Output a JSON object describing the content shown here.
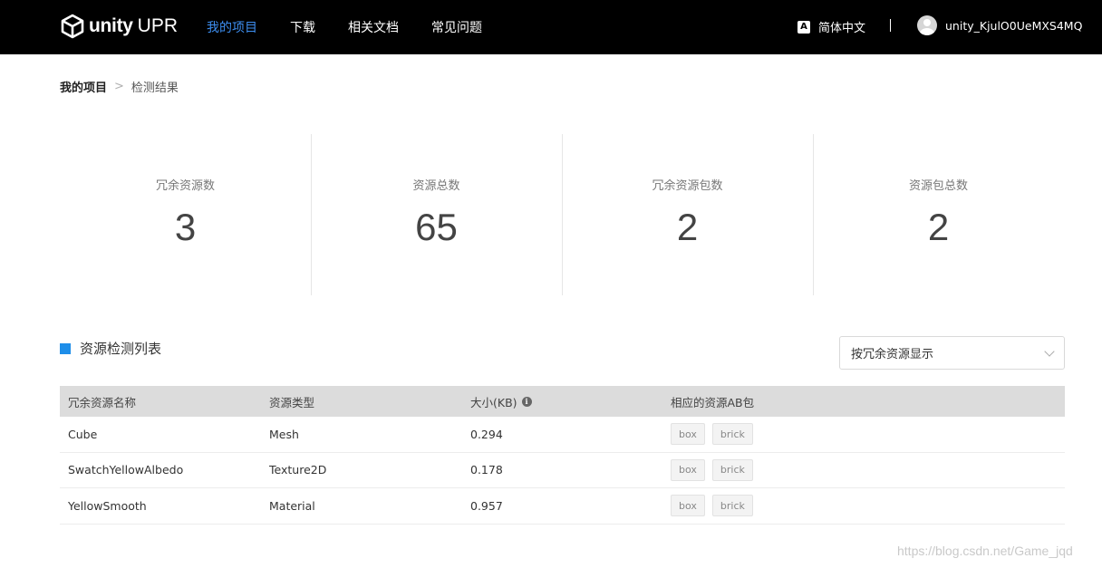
{
  "header": {
    "brand": "unity",
    "product": "UPR",
    "nav": [
      {
        "label": "我的项目",
        "active": true
      },
      {
        "label": "下载",
        "active": false
      },
      {
        "label": "相关文档",
        "active": false
      },
      {
        "label": "常见问题",
        "active": false
      }
    ],
    "language_icon": "A",
    "language": "简体中文",
    "username": "unity_KjulO0UeMXS4MQ"
  },
  "breadcrumb": {
    "root": "我的项目",
    "separator": ">",
    "current": "检测结果"
  },
  "stats": [
    {
      "label": "冗余资源数",
      "value": "3"
    },
    {
      "label": "资源总数",
      "value": "65"
    },
    {
      "label": "冗余资源包数",
      "value": "2"
    },
    {
      "label": "资源包总数",
      "value": "2"
    }
  ],
  "section": {
    "title": "资源检测列表",
    "filter_value": "按冗余资源显示"
  },
  "table": {
    "headers": [
      "冗余资源名称",
      "资源类型",
      "大小(KB)",
      "相应的资源AB包"
    ],
    "info_icon": "i",
    "rows": [
      {
        "name": "Cube",
        "type": "Mesh",
        "size": "0.294",
        "bundles": [
          "box",
          "brick"
        ]
      },
      {
        "name": "SwatchYellowAlbedo",
        "type": "Texture2D",
        "size": "0.178",
        "bundles": [
          "box",
          "brick"
        ]
      },
      {
        "name": "YellowSmooth",
        "type": "Material",
        "size": "0.957",
        "bundles": [
          "box",
          "brick"
        ]
      }
    ]
  },
  "watermark": "https://blog.csdn.net/Game_jqd",
  "colors": {
    "accent": "#1e8ee9",
    "nav_active": "#3d8ef0",
    "topbar": "#000000"
  }
}
